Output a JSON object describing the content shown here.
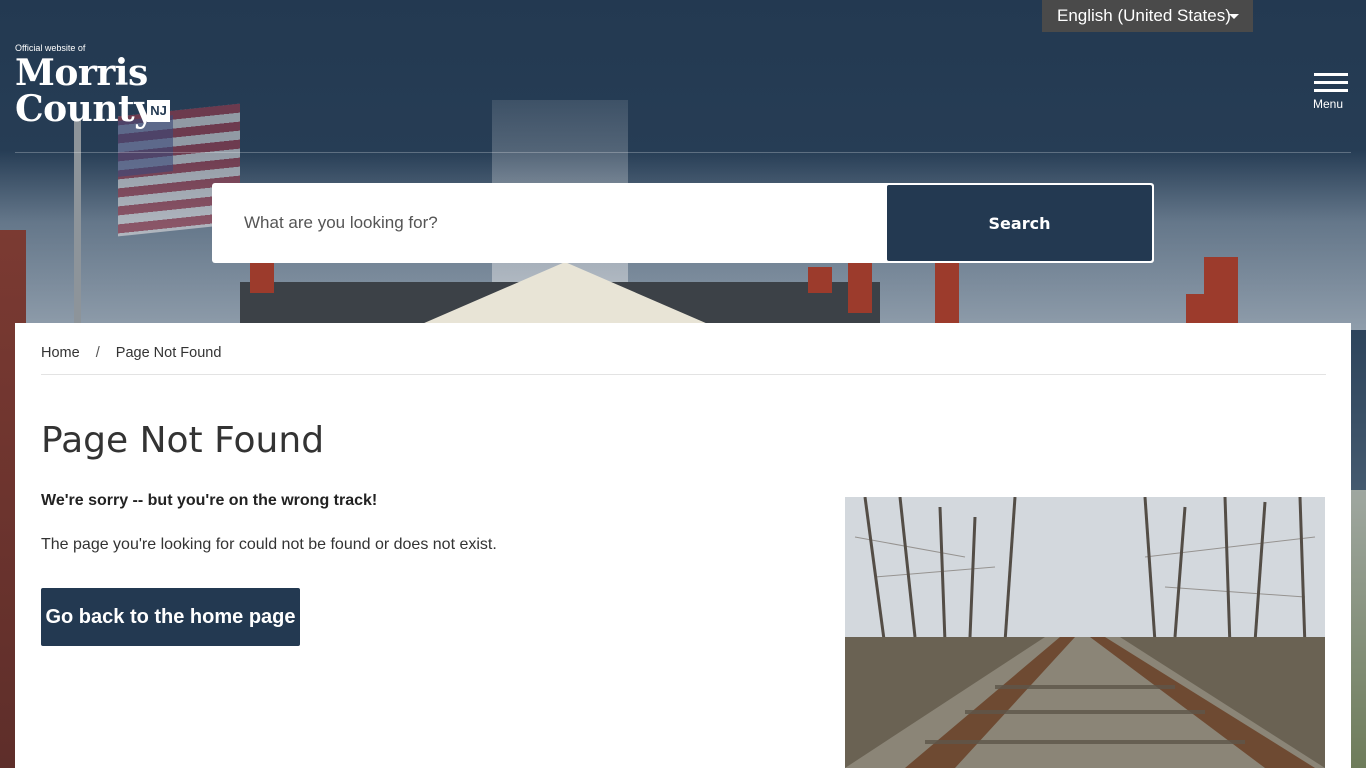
{
  "header": {
    "language": "English (United States)",
    "logo": {
      "official": "Official website of",
      "line1": "Morris",
      "line2": "County",
      "badge": "NJ"
    },
    "menu_label": "Menu"
  },
  "search": {
    "placeholder": "What are you looking for?",
    "button_label": "Search"
  },
  "breadcrumb": {
    "home": "Home",
    "separator": "/",
    "current": "Page Not Found"
  },
  "main": {
    "title": "Page Not Found",
    "sorry": "We're sorry -- but you're on the wrong track!",
    "description": "The page you're looking for could not be found or does not exist.",
    "home_button": "Go back to the home page"
  },
  "colors": {
    "brand_navy": "#233951",
    "white": "#ffffff"
  },
  "icons": [
    "chevron-down-icon",
    "hamburger-menu-icon"
  ]
}
